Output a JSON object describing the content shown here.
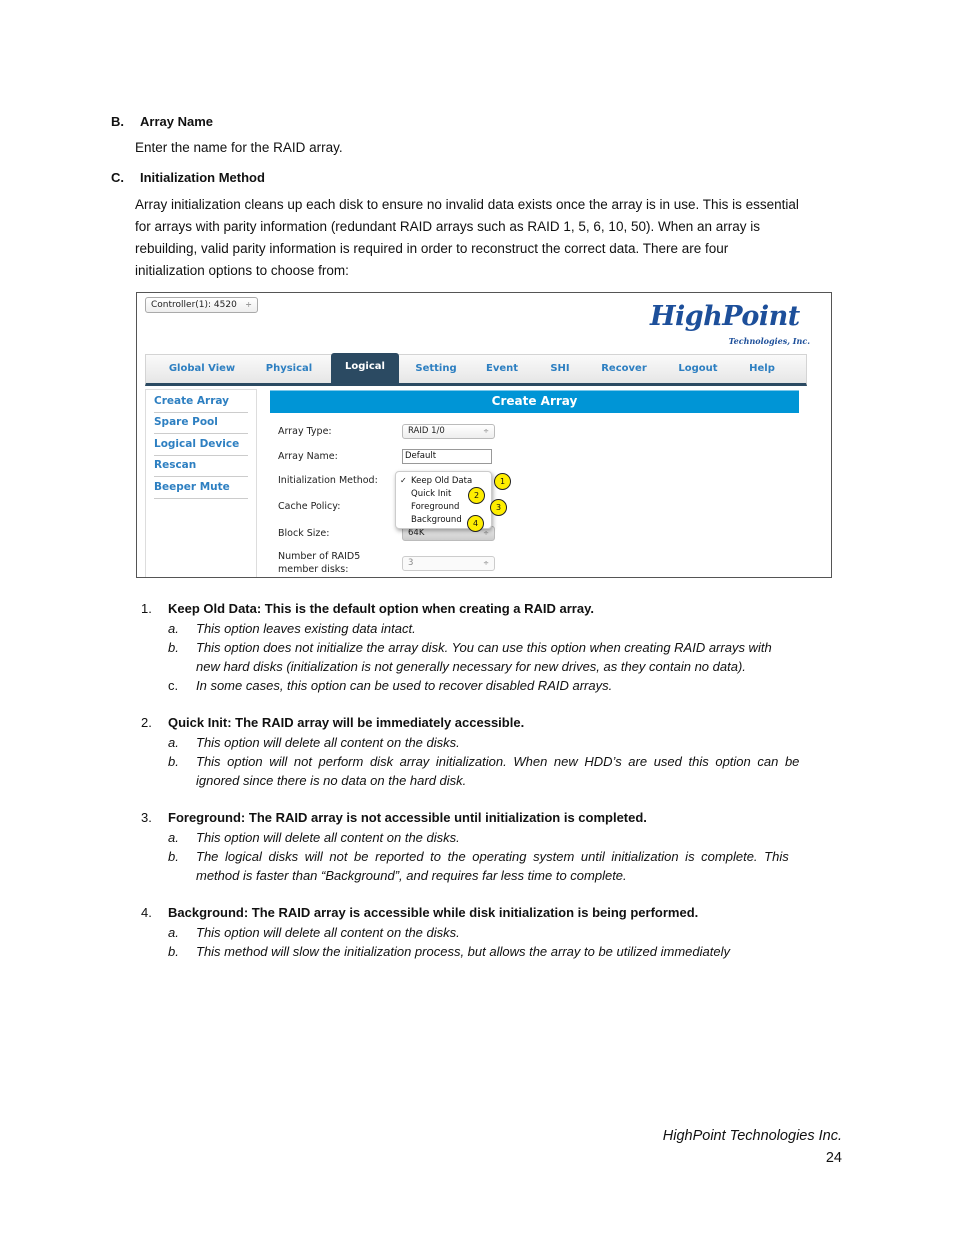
{
  "sections": {
    "b": {
      "letter": "B.",
      "title": "Array Name",
      "body": "Enter the name for the RAID array."
    },
    "c": {
      "letter": "C.",
      "title": "Initialization Method",
      "body_lines": [
        "Array initialization cleans up each disk to ensure no invalid data exists once the array is in use. This is essential",
        "for arrays with parity information (redundant RAID arrays such as RAID 1, 5, 6, 10, 50). When an array is",
        "rebuilding, valid parity information is required in order to reconstruct the correct data. There are four",
        "initialization options to choose from:"
      ]
    }
  },
  "screenshot": {
    "controller_select": "Controller(1): 4520",
    "logo": {
      "brand": "HighPoint",
      "tagline": "Technologies, Inc."
    },
    "nav_tabs": [
      {
        "label": "Global View",
        "active": false
      },
      {
        "label": "Physical",
        "active": false
      },
      {
        "label": "Logical",
        "active": true
      },
      {
        "label": "Setting",
        "active": false
      },
      {
        "label": "Event",
        "active": false
      },
      {
        "label": "SHI",
        "active": false
      },
      {
        "label": "Recover",
        "active": false
      },
      {
        "label": "Logout",
        "active": false
      },
      {
        "label": "Help",
        "active": false
      }
    ],
    "sidebar": [
      "Create Array",
      "Spare Pool",
      "Logical Device",
      "Rescan",
      "Beeper Mute"
    ],
    "banner_title": "Create Array",
    "form": {
      "array_type_label": "Array Type:",
      "array_type_value": "RAID 1/0",
      "array_name_label": "Array Name:",
      "array_name_value": "Default",
      "init_method_label": "Initialization Method:",
      "cache_policy_label": "Cache Policy:",
      "block_size_label": "Block Size:",
      "block_size_value": "64K",
      "member_disks_label_1": "Number of RAID5",
      "member_disks_label_2": "member disks:",
      "member_disks_value": "3"
    },
    "dropdown": {
      "check": "✓",
      "options": [
        "Keep Old Data",
        "Quick Init",
        "Foreground",
        "Background"
      ],
      "selected": "Keep Old Data"
    },
    "callouts": [
      "1",
      "2",
      "3",
      "4"
    ],
    "select_arrow": "÷"
  },
  "options_list": [
    {
      "num": "1.",
      "title": "Keep Old Data: This is the default option when creating a RAID array.",
      "items": [
        {
          "letter": "a.",
          "lines": [
            "This option leaves existing data intact."
          ]
        },
        {
          "letter": "b.",
          "lines": [
            "This option does not initialize the array disk. You can use this option when creating RAID arrays with",
            "new hard disks (initialization is not generally necessary for new drives, as they contain no data)."
          ]
        },
        {
          "letter": "c.",
          "lines": [
            "In some cases, this option can be used to recover disabled RAID arrays."
          ]
        }
      ]
    },
    {
      "num": "2.",
      "title": "Quick Init: The RAID array will be immediately accessible.",
      "items": [
        {
          "letter": "a.",
          "lines": [
            "This option will delete all content on the disks."
          ]
        },
        {
          "letter": "b.",
          "lines": [
            "This option will not perform disk array initialization. When new HDD’s are used this option can be",
            "ignored since there is no data on the hard disk."
          ]
        }
      ]
    },
    {
      "num": "3.",
      "title": "Foreground: The RAID array is not accessible until initialization is completed.",
      "items": [
        {
          "letter": "a.",
          "lines": [
            "This option will delete all content on the disks."
          ]
        },
        {
          "letter": "b.",
          "lines": [
            "The logical disks will not be reported to the operating system until initialization is complete. This",
            "method is faster than “Background”, and requires far less time to complete."
          ]
        }
      ]
    },
    {
      "num": "4.",
      "title": "Background: The RAID array is accessible while disk initialization is being performed.",
      "items": [
        {
          "letter": "a.",
          "lines": [
            "This option will delete all content on the disks."
          ]
        },
        {
          "letter": "b.",
          "lines": [
            "This method will slow the initialization process, but allows the array to be utilized immediately"
          ]
        }
      ]
    }
  ],
  "footer": {
    "company": "HighPoint Technologies Inc.",
    "page": "24"
  }
}
